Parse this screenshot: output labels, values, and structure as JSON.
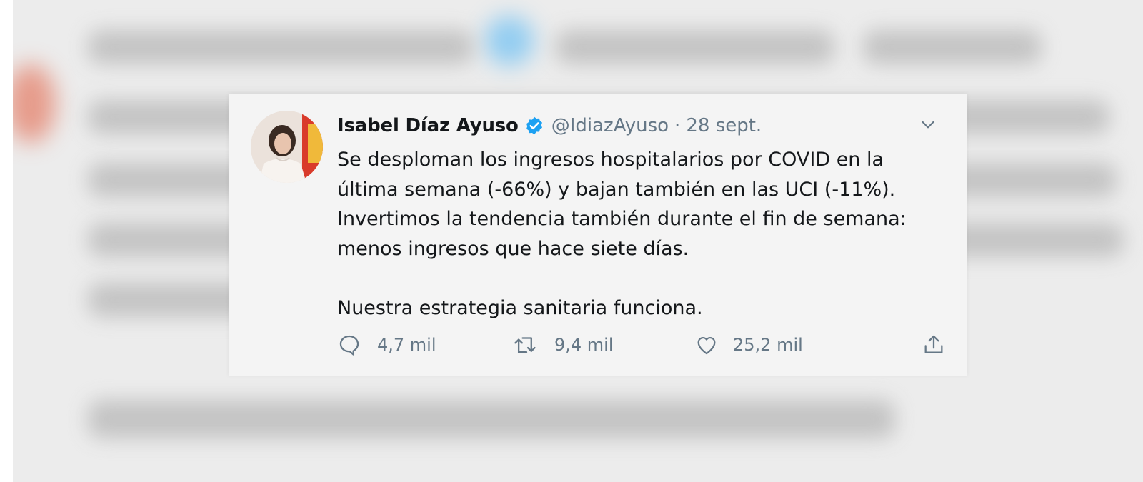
{
  "tweet": {
    "author_name": "Isabel Díaz Ayuso",
    "handle": "@IdiazAyuso",
    "separator": "·",
    "date": "28 sept.",
    "verified_icon": "verified-badge-icon",
    "paragraphs": [
      "Se desploman los ingresos hospitalarios por COVID en la",
      "última semana (-66%) y bajan también en las UCI (-11%).",
      "Invertimos la tendencia también durante el fin de semana:",
      "menos ingresos que hace siete días."
    ],
    "closing": "Nuestra estrategia sanitaria funciona.",
    "actions": {
      "reply_count": "4,7 mil",
      "retweet_count": "9,4 mil",
      "like_count": "25,2 mil"
    }
  },
  "colors": {
    "card_background": "#f4f4f4",
    "text_primary": "#14171a",
    "text_secondary": "#657786",
    "verified_blue": "#1da1f2"
  }
}
